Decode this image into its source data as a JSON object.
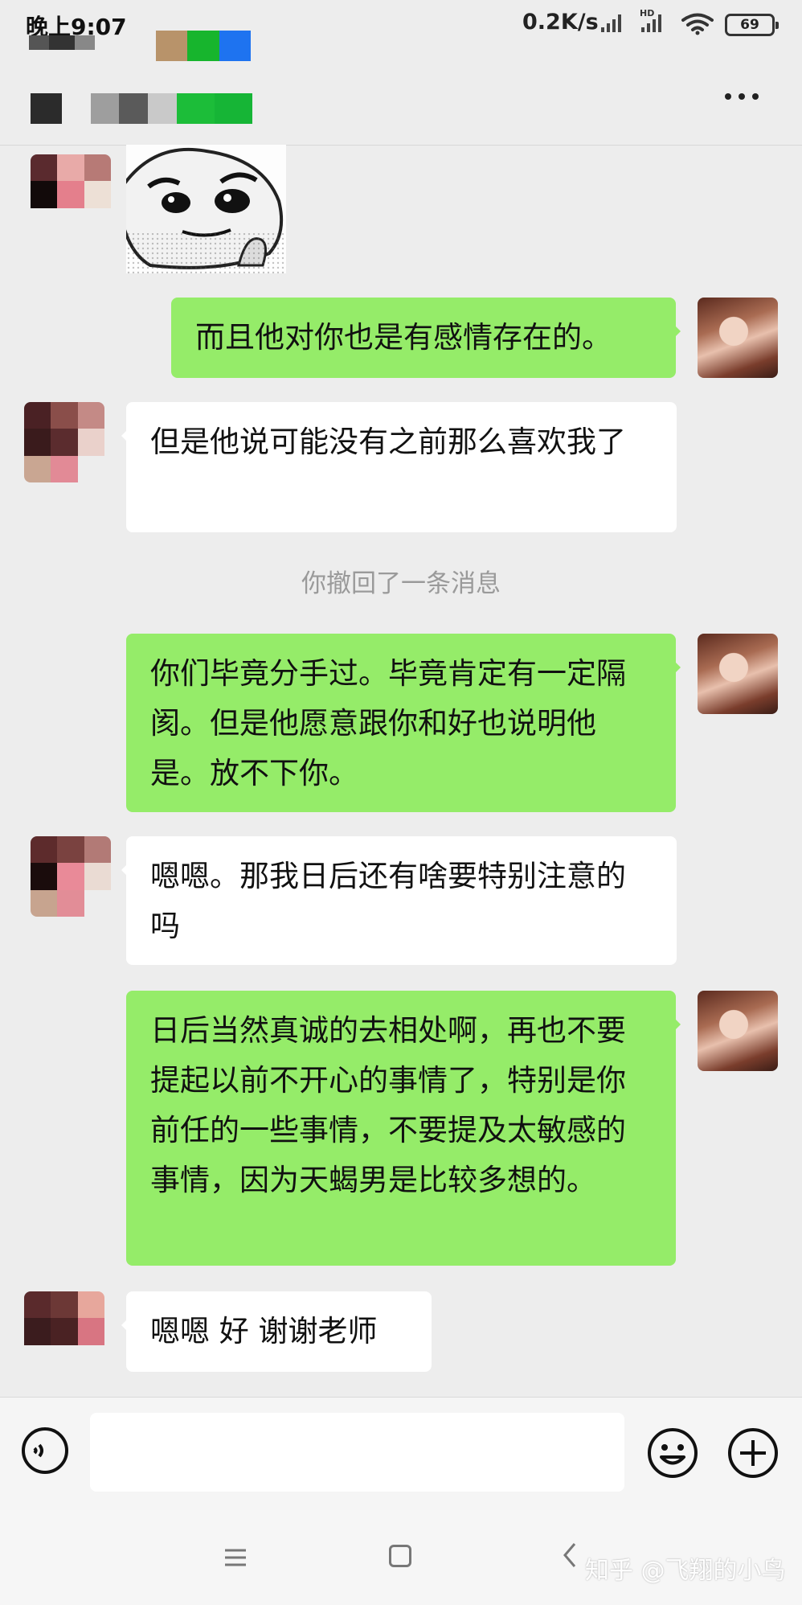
{
  "status_bar": {
    "time": "晚上9:07",
    "network_speed": "0.2K/s",
    "hd_label": "HD",
    "battery": "69"
  },
  "colors": {
    "background": "#ededed",
    "outgoing_bubble": "#95ec69",
    "incoming_bubble": "#ffffff",
    "system_text": "#9a9a9a"
  },
  "chat": {
    "messages": [
      {
        "direction": "incoming",
        "type": "sticker"
      },
      {
        "direction": "outgoing",
        "type": "text",
        "text": "而且他对你也是有感情存在的。"
      },
      {
        "direction": "incoming",
        "type": "text",
        "text": "但是他说可能没有之前那么喜欢我了"
      },
      {
        "direction": "system",
        "type": "notice",
        "text": "你撤回了一条消息"
      },
      {
        "direction": "outgoing",
        "type": "text",
        "text": "你们毕竟分手过。毕竟肯定有一定隔阂。但是他愿意跟你和好也说明他是。放不下你。"
      },
      {
        "direction": "incoming",
        "type": "text",
        "text": "嗯嗯。那我日后还有啥要特别注意的吗"
      },
      {
        "direction": "outgoing",
        "type": "text",
        "text": "日后当然真诚的去相处啊，再也不要提起以前不开心的事情了，特别是你前任的一些事情，不要提及太敏感的事情，因为天蝎男是比较多想的。"
      },
      {
        "direction": "incoming",
        "type": "text",
        "text": "嗯嗯 好 谢谢老师"
      }
    ]
  },
  "input_bar": {
    "icons": [
      "voice-icon",
      "emoji-icon",
      "plus-icon"
    ]
  },
  "nav_bar": {
    "icons": [
      "menu-icon",
      "home-icon",
      "back-icon"
    ]
  },
  "watermark": "知乎 @飞翔的小鸟"
}
